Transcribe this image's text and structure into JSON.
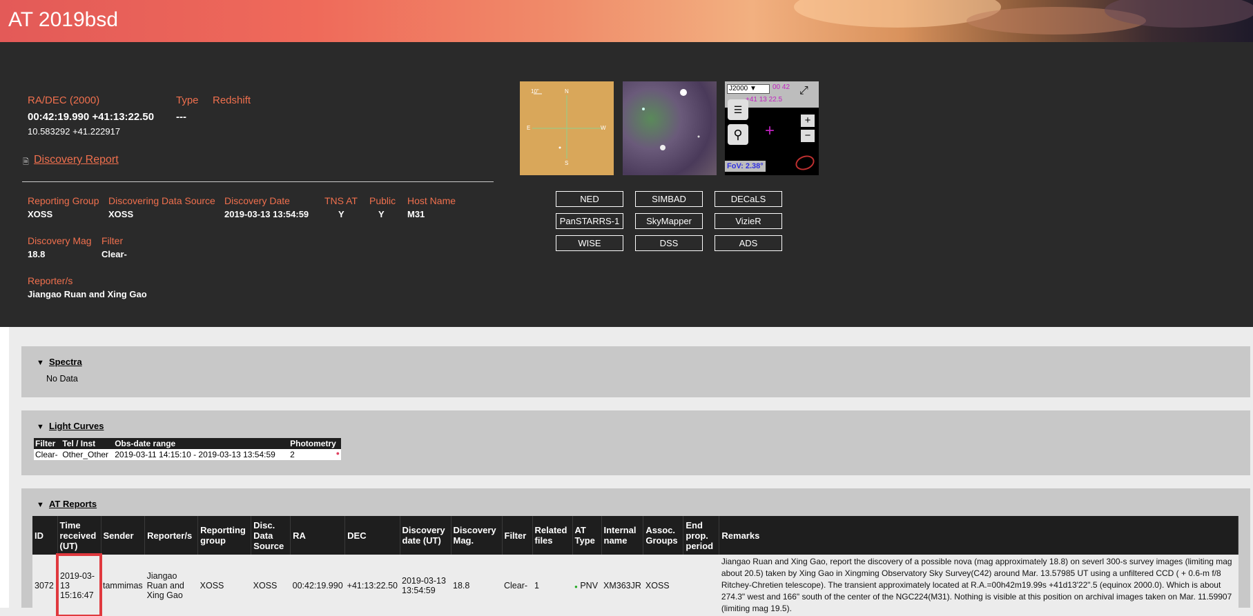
{
  "page_title": "AT 2019bsd",
  "summary": {
    "radec_label": "RA/DEC (2000)",
    "radec_sexagesimal": "00:42:19.990 +41:13:22.50",
    "radec_decimal": "10.583292 +41.222917",
    "type_label": "Type",
    "type_value": "---",
    "redshift_label": "Redshift",
    "discovery_report_link": "Discovery Report"
  },
  "details": {
    "reporting_group_label": "Reporting Group",
    "reporting_group": "XOSS",
    "discovering_source_label": "Discovering Data Source",
    "discovering_source": "XOSS",
    "discovery_date_label": "Discovery Date",
    "discovery_date": "2019-03-13 13:54:59",
    "tns_at_label": "TNS AT",
    "tns_at": "Y",
    "public_label": "Public",
    "public": "Y",
    "host_name_label": "Host Name",
    "host_name": "M31",
    "discovery_mag_label": "Discovery Mag",
    "discovery_mag": "18.8",
    "filter_label": "Filter",
    "filter": "Clear-",
    "reporters_label": "Reporter/s",
    "reporters": "Jiangao Ruan and Xing Gao"
  },
  "aladin": {
    "frame": "J2000 ▼",
    "coords_line1": "00 42",
    "coords_line2": "+41 13 22.5",
    "fov": "FoV: 2.38°",
    "zoom_in": "+",
    "zoom_out": "−"
  },
  "finder": {
    "scale": "10\"",
    "north": "N",
    "south": "S",
    "east": "E",
    "west": "W"
  },
  "links": [
    "NED",
    "SIMBAD",
    "DECaLS",
    "PanSTARRS-1",
    "SkyMapper",
    "VizieR",
    "WISE",
    "DSS",
    "ADS"
  ],
  "spectra": {
    "title": "Spectra",
    "empty": "No Data"
  },
  "light_curves": {
    "title": "Light Curves",
    "headers": [
      "Filter",
      "Tel / Inst",
      "Obs-date range",
      "Photometry"
    ],
    "row": [
      "Clear-",
      "Other_Other",
      "2019-03-11 14:15:10 - 2019-03-13 13:54:59",
      "2"
    ]
  },
  "at_reports": {
    "title": "AT Reports",
    "headers": [
      "ID",
      "Time received (UT)",
      "Sender",
      "Reporter/s",
      "Reportting group",
      "Disc. Data Source",
      "RA",
      "DEC",
      "Discovery date (UT)",
      "Discovery Mag.",
      "Filter",
      "Related files",
      "AT Type",
      "Internal name",
      "Assoc. Groups",
      "End prop. period",
      "Remarks"
    ],
    "row": {
      "id": "3072",
      "time": "2019-03-13 15:16:47",
      "sender": "tammimas",
      "reporters": "Jiangao Ruan and Xing Gao",
      "group": "XOSS",
      "source": "XOSS",
      "ra": "00:42:19.990",
      "dec": "+41:13:22.50",
      "date": "2019-03-13 13:54:59",
      "mag": "18.8",
      "filter": "Clear-",
      "files": "1",
      "type": "PNV",
      "internal": "XM363JR",
      "assoc": "XOSS",
      "end": "",
      "remarks": "Jiangao Ruan and Xing Gao, report the discovery of a possible nova (mag approximately 18.8) on severl 300-s survey images (limiting mag about 20.5) taken by Xing Gao in Xingming Observatory Sky Survey(C42) around Mar. 13.57985 UT using a unfiltered CCD ( + 0.6-m f/8 Ritchey-Chretien telescope). The transient approximately located at R.A.=00h42m19.99s +41d13'22\".5 (equinox 2000.0). Which is about 274.3\" west and 166\" south of the center of the NGC224(M31). Nothing is visible at this position on archival images taken on Mar. 11.59907 (limiting mag 19.5)."
    }
  },
  "colors": {
    "accent": "#f0704e",
    "dark_bg": "#2a2a2a",
    "highlight": "#e0393e"
  }
}
